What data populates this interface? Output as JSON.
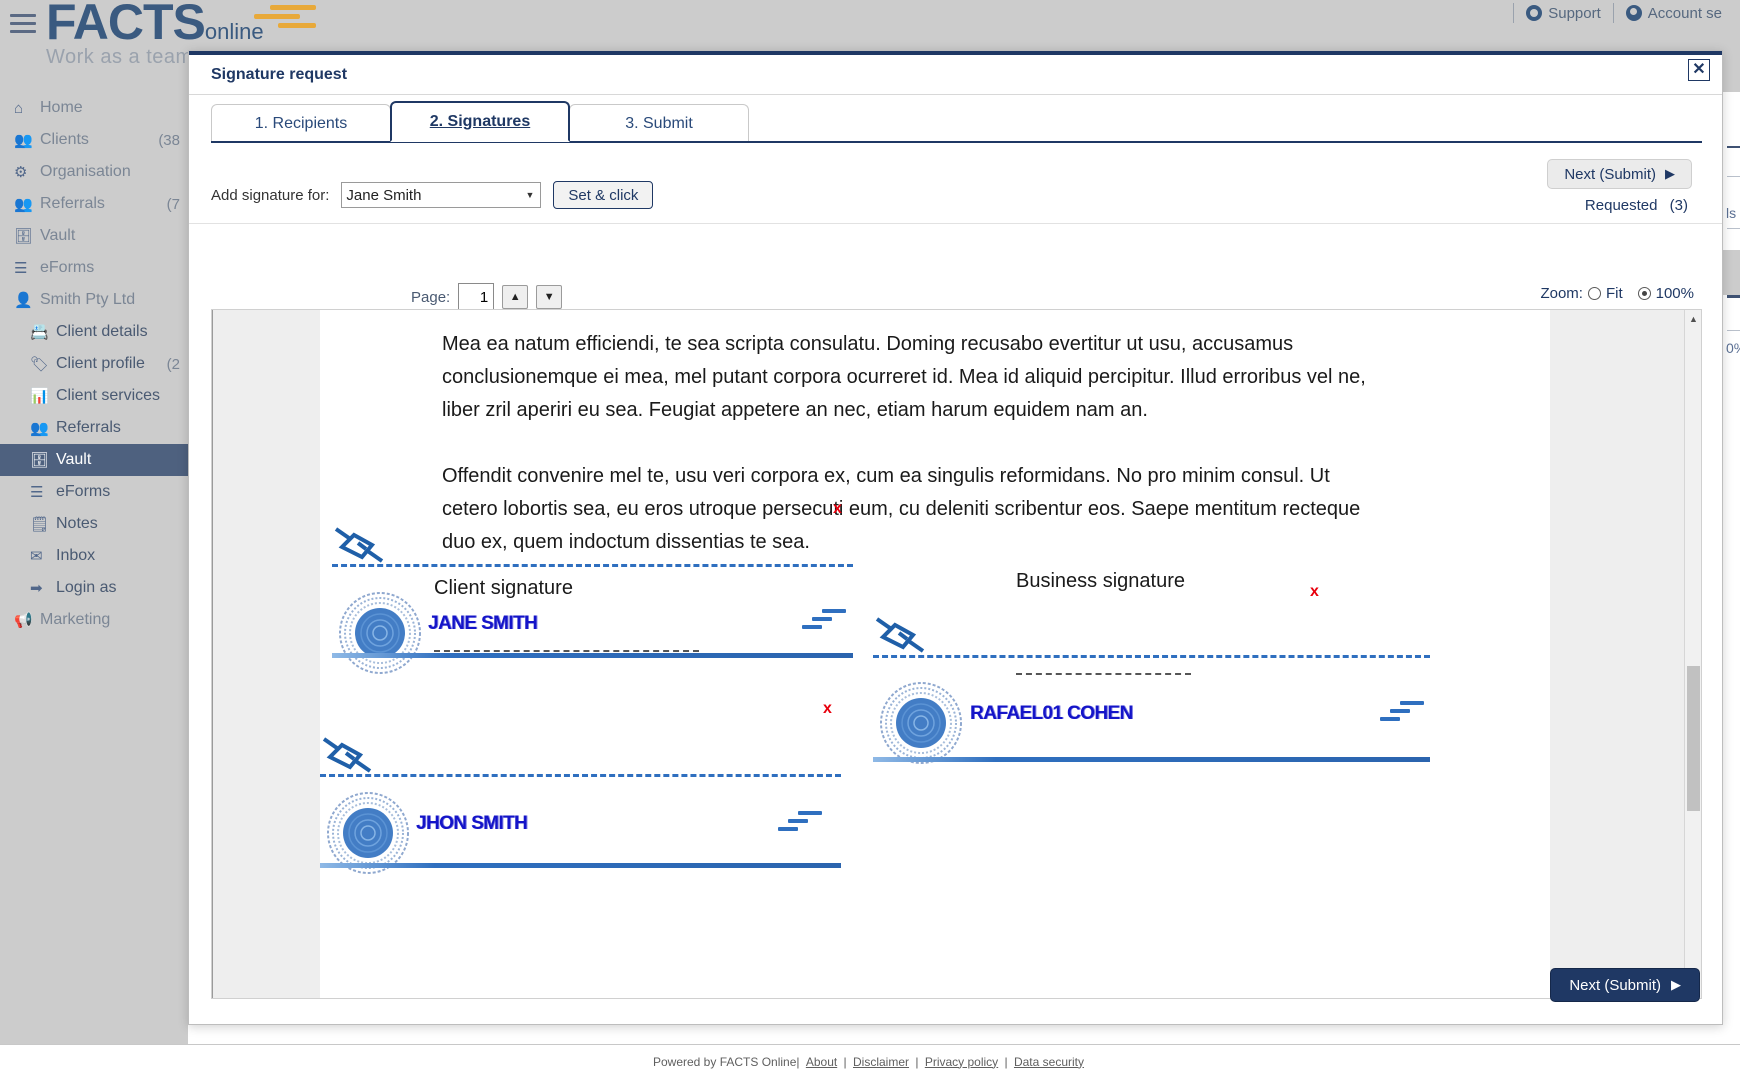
{
  "topbar": {
    "logo_main": "FACTS",
    "logo_sub": "online",
    "tagline": "Work as a team w",
    "support_label": "Support",
    "account_label": "Account se"
  },
  "sidebar": {
    "items": [
      {
        "label": "Home",
        "icon": "home-icon",
        "count": "",
        "level": 0,
        "active": false
      },
      {
        "label": "Clients",
        "icon": "clients-icon",
        "count": "(38",
        "level": 0,
        "active": false
      },
      {
        "label": "Organisation",
        "icon": "organisation-icon",
        "count": "",
        "level": 0,
        "active": false
      },
      {
        "label": "Referrals",
        "icon": "referrals-icon",
        "count": "(7",
        "level": 0,
        "active": false
      },
      {
        "label": "Vault",
        "icon": "vault-icon",
        "count": "",
        "level": 0,
        "active": false
      },
      {
        "label": "eForms",
        "icon": "eforms-icon",
        "count": "",
        "level": 0,
        "active": false
      },
      {
        "label": "Smith Pty Ltd",
        "icon": "person-icon",
        "count": "",
        "level": 0,
        "active": false
      },
      {
        "label": "Client details",
        "icon": "id-card-icon",
        "count": "",
        "level": 1,
        "active": false
      },
      {
        "label": "Client profile",
        "icon": "tag-icon",
        "count": "(2",
        "level": 1,
        "active": false
      },
      {
        "label": "Client services",
        "icon": "chart-icon",
        "count": "",
        "level": 1,
        "active": false
      },
      {
        "label": "Referrals",
        "icon": "referrals-icon",
        "count": "",
        "level": 1,
        "active": false
      },
      {
        "label": "Vault",
        "icon": "vault-icon",
        "count": "",
        "level": 1,
        "active": true
      },
      {
        "label": "eForms",
        "icon": "eforms-icon",
        "count": "",
        "level": 1,
        "active": false
      },
      {
        "label": "Notes",
        "icon": "notes-icon",
        "count": "",
        "level": 1,
        "active": false
      },
      {
        "label": "Inbox",
        "icon": "inbox-icon",
        "count": "",
        "level": 1,
        "active": false
      },
      {
        "label": "Login as",
        "icon": "login-icon",
        "count": "",
        "level": 1,
        "active": false
      },
      {
        "label": "Marketing",
        "icon": "megaphone-icon",
        "count": "",
        "level": 0,
        "active": false
      }
    ]
  },
  "background": {
    "fragment_text_1": "ls",
    "fragment_text_2": "0%"
  },
  "modal": {
    "title": "Signature request",
    "close_label": "✕",
    "tabs": [
      {
        "label": "1. Recipients",
        "active": false
      },
      {
        "label": "2. Signatures",
        "active": true
      },
      {
        "label": "3. Submit",
        "active": false
      }
    ],
    "add_signature_label": "Add signature for:",
    "selected_signer": "Jane Smith",
    "signer_options": [
      "Jane Smith",
      "Jhon Smith",
      "Rafael01 Cohen"
    ],
    "set_click_label": "Set & click",
    "next_top_label": "Next (Submit)",
    "next_arrow": "▶",
    "requested_label": "Requested",
    "requested_count": "(3)",
    "page_label": "Page:",
    "page_value": "1",
    "page_up_icon": "▲",
    "page_down_icon": "▼",
    "zoom_label": "Zoom:",
    "zoom_fit_label": "Fit",
    "zoom_100_label": "100%",
    "zoom_selected": "100%",
    "next_bottom_label": "Next (Submit)"
  },
  "document": {
    "paragraph_1": "Mea ea natum efficiendi, te sea scripta consulatu. Doming recusabo evertitur ut usu, accusamus conclusionemque ei mea, mel putant corpora ocurreret id. Mea id aliquid percipitur. Illud erroribus vel ne, liber zril aperiri eu sea. Feugiat appetere an nec, etiam harum equidem nam an.",
    "paragraph_2": "Offendit convenire mel te, usu veri corpora ex, cum ea singulis reformidans. No pro minim consul. Ut cetero lobortis sea, eu eros utroque persecuti eum, cu deleniti scribentur eos. Saepe mentitum recteque duo ex, quem indoctum dissentias te sea.",
    "client_signature_caption": "Client signature",
    "business_signature_caption": "Business signature",
    "signature_1_name": "JANE SMITH",
    "signature_2_name": "RAFAEL01 COHEN",
    "signature_3_name": "JHON SMITH",
    "placement_marker": "x",
    "markers": [
      "x",
      "x",
      "x"
    ]
  },
  "footer": {
    "powered_by": "Powered by FACTS Online",
    "links": [
      "About",
      "Disclaimer",
      "Privacy policy",
      "Data security"
    ],
    "separator": "|"
  },
  "colors": {
    "brand_navy": "#1f3864",
    "brand_steel": "#3a5a80",
    "accent_gold": "#e8a93a",
    "sidebar_bg": "#cccccc",
    "active_nav": "#4e617f",
    "signature_blue": "#1414c8",
    "marker_red": "#e8000d"
  }
}
